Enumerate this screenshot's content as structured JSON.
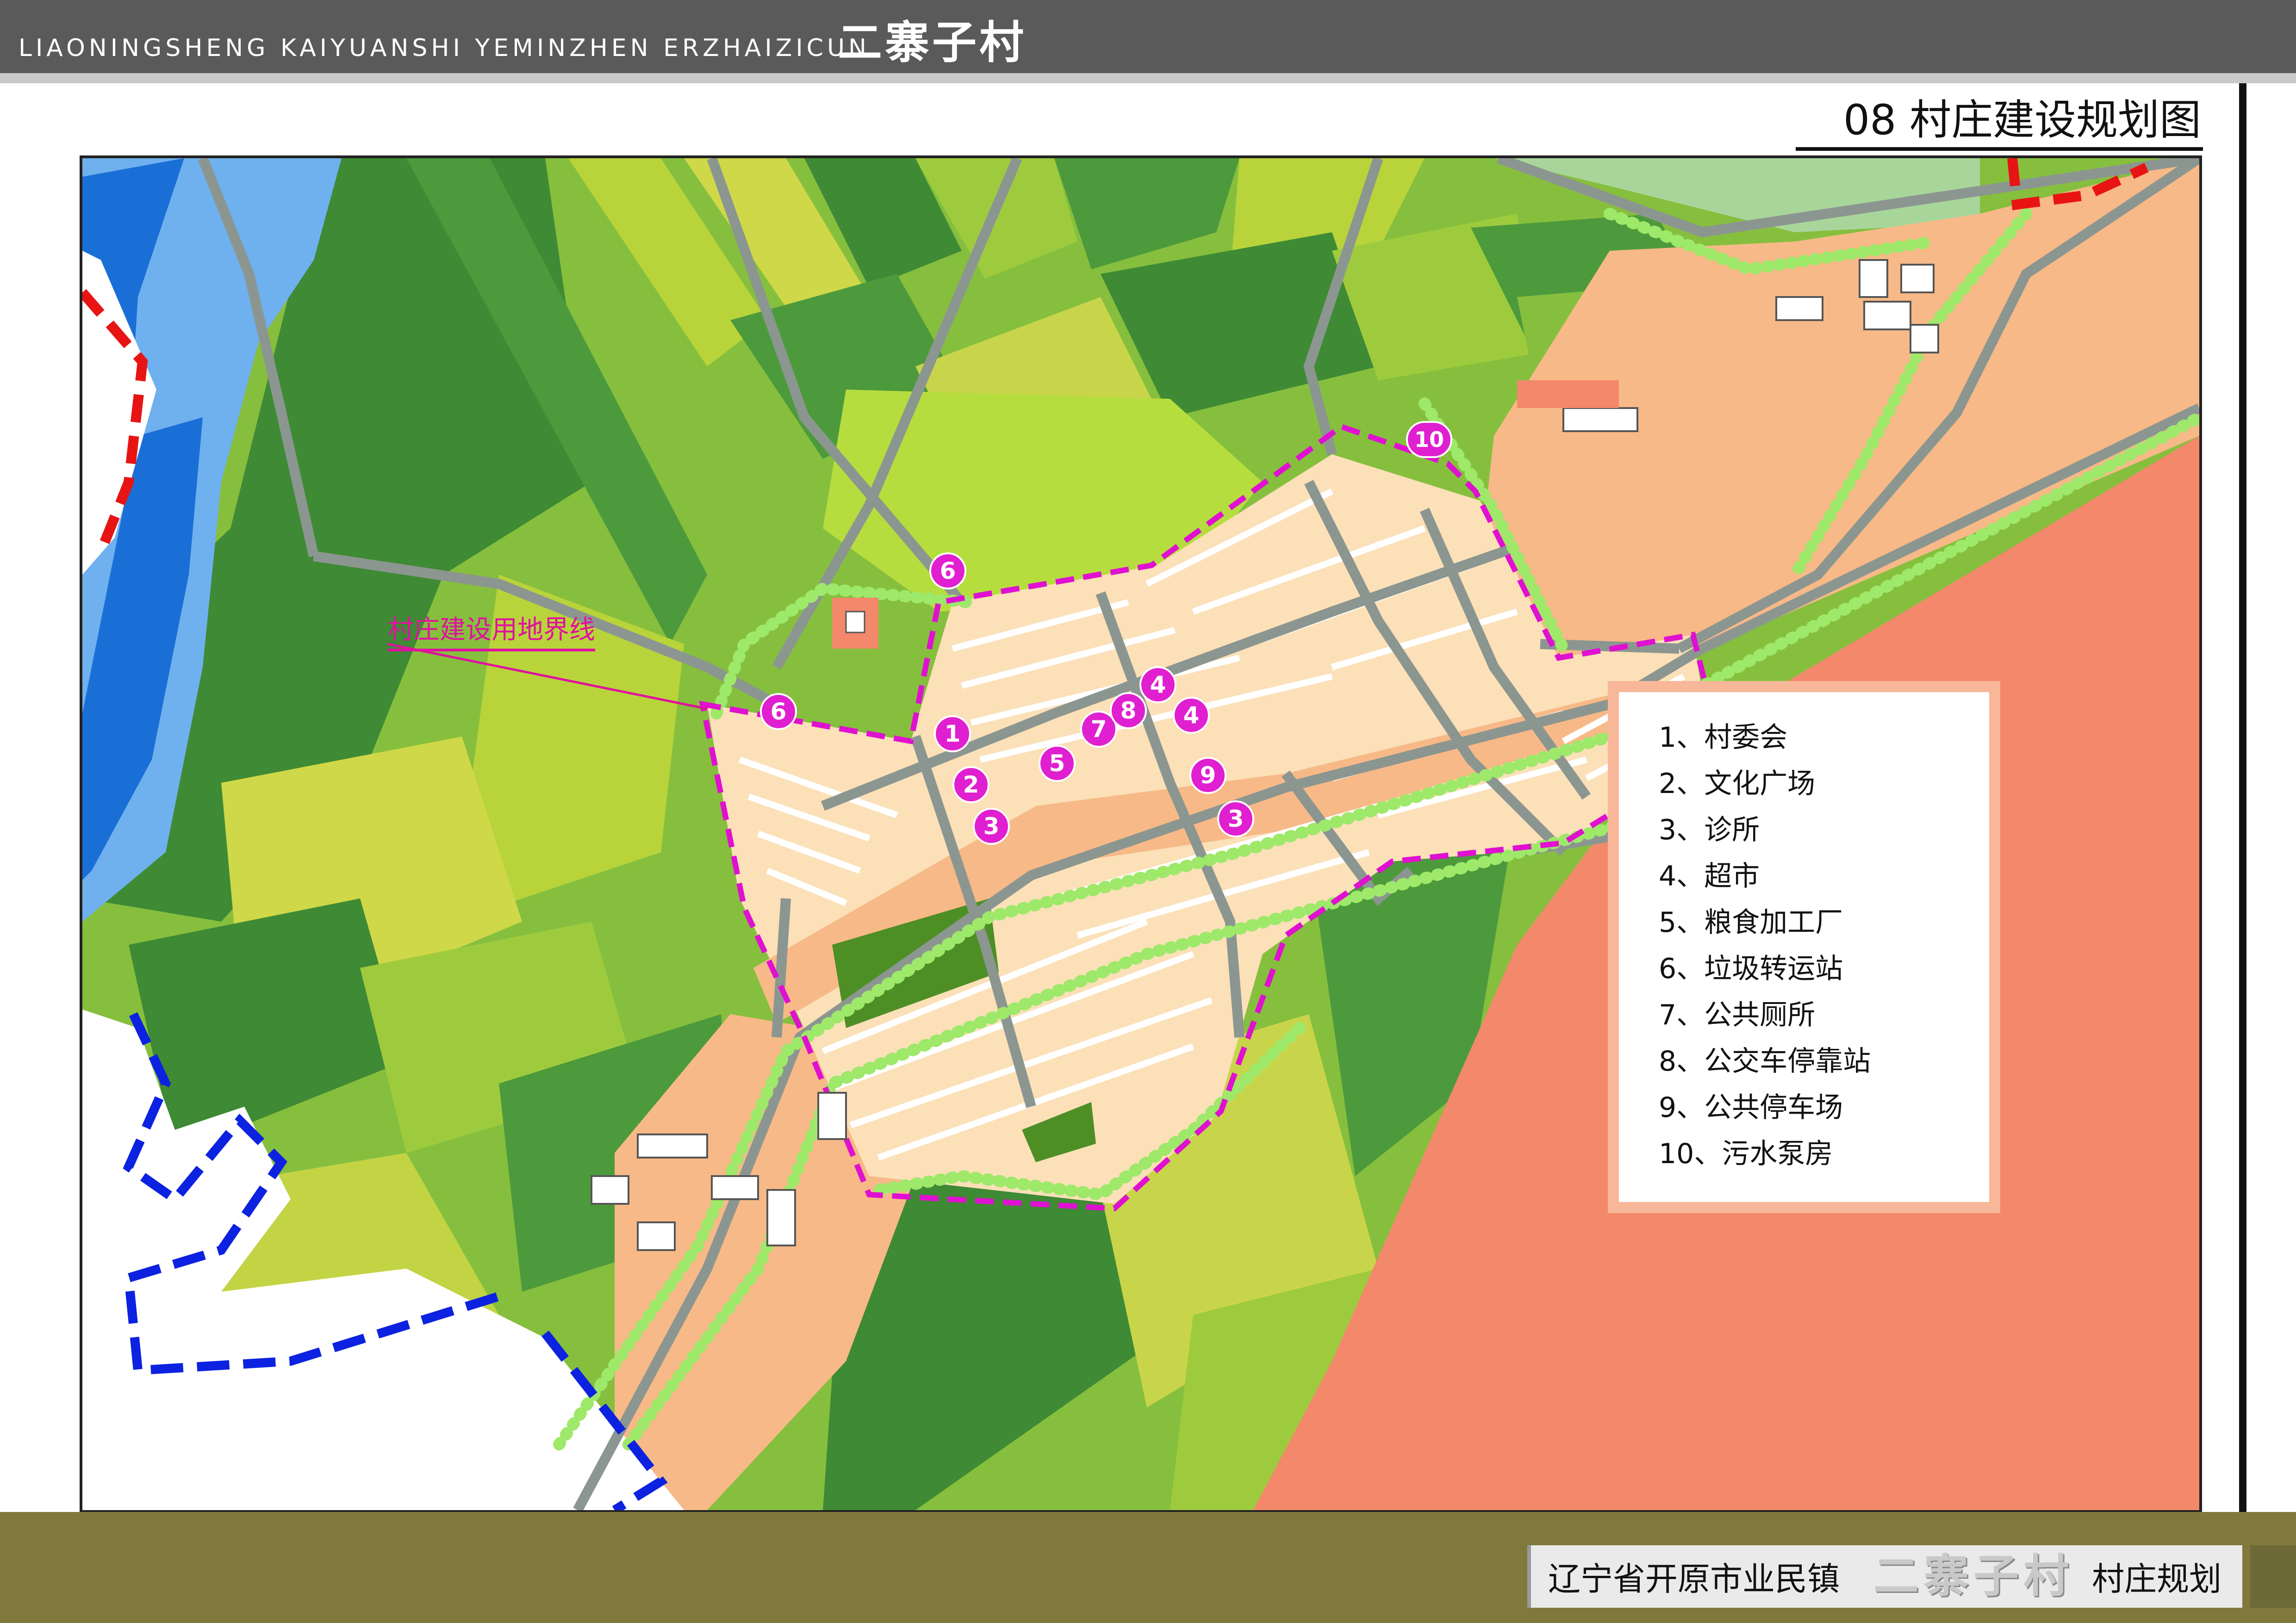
{
  "header": {
    "pinyin": "LIAONINGSHENG KAIYUANSHI YEMINZHEN ERZHAIZICUN",
    "village_cn": "二寨子村",
    "title": "08 村庄建设规划图"
  },
  "map": {
    "boundary_label": "村庄建设用地界线",
    "markers": [
      "1",
      "2",
      "3",
      "4",
      "5",
      "6",
      "7",
      "8",
      "9",
      "3",
      "4",
      "6",
      "10"
    ],
    "colors": {
      "river": "#1a6fd6",
      "river_light": "#6fb0ee",
      "farmland_dark": "#3f8a34",
      "farmland_mid": "#7ab83a",
      "farmland_light": "#b8d43a",
      "farmland_yellow": "#d2d64c",
      "residential": "#fbe0b8",
      "road": "#8c9690",
      "industrial": "#f3886b",
      "reserve": "#f7b987",
      "boundary": "#e010d0",
      "trees": "#9ee86a",
      "marker": "#e020d0"
    }
  },
  "legend": {
    "items": [
      "1、村委会",
      "2、文化广场",
      "3、诊所",
      "4、超市",
      "5、粮食加工厂",
      "6、垃圾转运站",
      "7、公共厕所",
      "8、公交车停靠站",
      "9、公共停车场",
      "10、污水泵房"
    ]
  },
  "footer": {
    "prefix": "辽宁省开原市业民镇",
    "village": "二寨子村",
    "suffix": "村庄规划"
  }
}
